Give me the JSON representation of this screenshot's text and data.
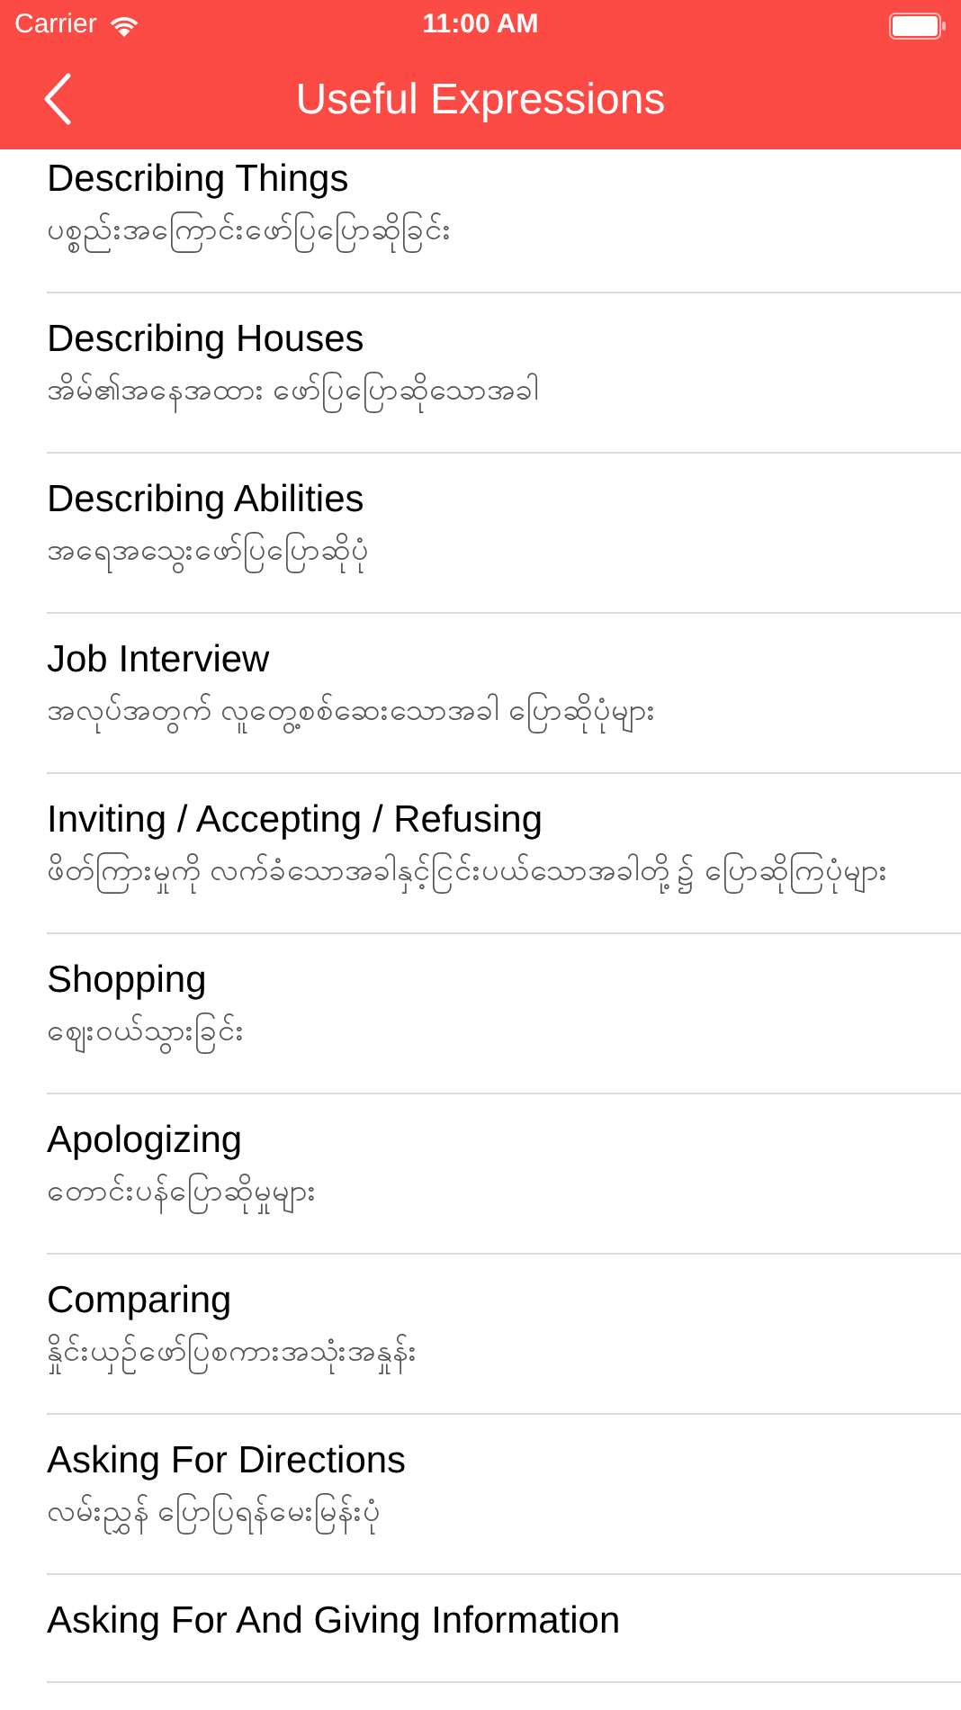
{
  "status_bar": {
    "carrier": "Carrier",
    "time": "11:00 AM"
  },
  "nav": {
    "title": "Useful Expressions"
  },
  "items": [
    {
      "title": "Describing Things",
      "subtitle": "ပစ္စည်းအကြောင်းဖော်ပြပြောဆိုခြင်း"
    },
    {
      "title": "Describing Houses",
      "subtitle": "အိမ်၏အနေအထား ဖော်ပြပြောဆိုသောအခါ"
    },
    {
      "title": "Describing Abilities",
      "subtitle": "အရေအသွေးဖော်ပြပြောဆိုပုံ"
    },
    {
      "title": "Job Interview",
      "subtitle": "အလုပ်အတွက် လူတွေ့စစ်ဆေးသောအခါ ပြောဆိုပုံများ"
    },
    {
      "title": "Inviting / Accepting / Refusing",
      "subtitle": "ဖိတ်ကြားမှုကို လက်ခံသောအခါနှင့်ငြင်းပယ်သောအခါတို့၌ ပြောဆိုကြပုံများ"
    },
    {
      "title": "Shopping",
      "subtitle": "ဈေးဝယ်သွားခြင်း"
    },
    {
      "title": "Apologizing",
      "subtitle": "တောင်းပန်ပြောဆိုမှုများ"
    },
    {
      "title": "Comparing",
      "subtitle": "နှိုင်းယှဉ်ဖော်ပြစကားအသုံးအနှုန်း"
    },
    {
      "title": "Asking For Directions",
      "subtitle": "လမ်းညွှန် ပြောပြရန်မေးမြန်းပုံ"
    },
    {
      "title": "Asking For And Giving Information"
    }
  ]
}
